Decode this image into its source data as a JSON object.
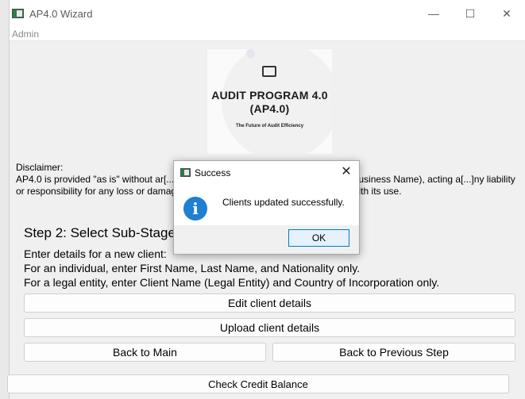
{
  "window": {
    "title": "AP4.0 Wizard",
    "minimize_glyph": "—",
    "maximize_glyph": "☐",
    "close_glyph": "✕"
  },
  "menu": {
    "items": [
      "Admin"
    ]
  },
  "logo": {
    "title_line1": "AUDIT PROGRAM 4.0",
    "title_line2": "(AP4.0)",
    "tagline": "The Future of Audit Efficiency"
  },
  "disclaimer": {
    "label": "Disclaimer:",
    "text": "AP4.0 is provided \"as is\" without ar[...] Limited, and EQC Compliance Advisory (Business Name), acting a[...]ny liability or responsibility for any loss or damage incurred as a result[...] risks associated with its use."
  },
  "step": {
    "title": "Step 2: Select Sub-Stage",
    "instructions": [
      "Enter details for a new client:",
      "For an individual, enter First Name, Last Name, and Nationality only.",
      "For a legal entity, enter Client Name (Legal Entity) and Country of Incorporation only."
    ]
  },
  "buttons": {
    "edit": "Edit client details",
    "upload": "Upload client details",
    "back_main": "Back to Main",
    "back_prev": "Back to Previous Step",
    "credit": "Check Credit Balance"
  },
  "dialog": {
    "title": "Success",
    "close_glyph": "✕",
    "message": "Clients updated successfully.",
    "icon": "info-icon",
    "ok_label": "OK"
  },
  "colors": {
    "accent": "#0078d7",
    "info": "#1f7fd1",
    "brand": "#2b7d4a"
  }
}
